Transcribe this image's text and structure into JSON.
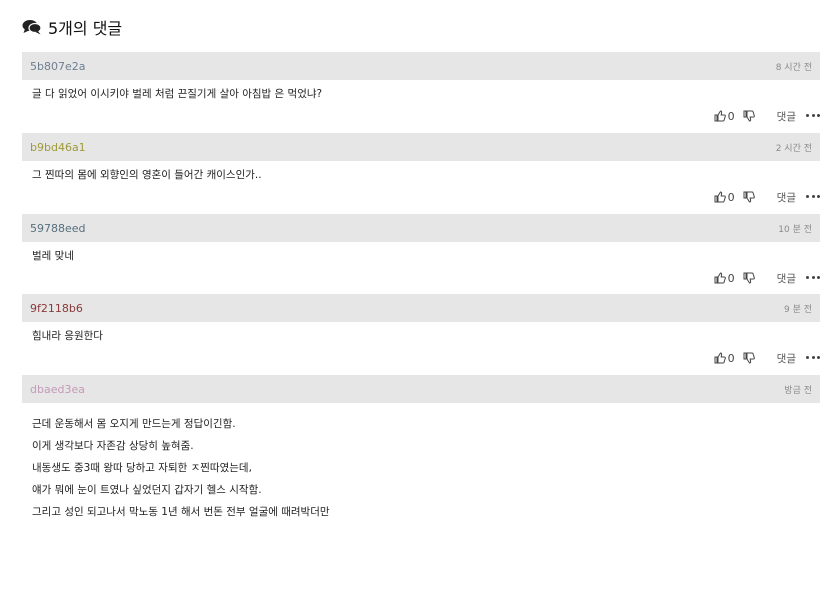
{
  "header": {
    "title": "5개의 댓글",
    "icon": "comments-icon"
  },
  "comments": [
    {
      "author": "5b807e2a",
      "author_color": "#6e7f90",
      "time": "8 시간 전",
      "text": "글 다 읽었어 이시키야 벌레 처럼 끈질기게 살아 아침밥 은 먹었냐?",
      "likes": "0",
      "reply_label": "댓글"
    },
    {
      "author": "b9bd46a1",
      "author_color": "#a09a3a",
      "time": "2 시간 전",
      "text": "그 찐따의 몸에 외향인의 영혼이 들어간 캐이스인가..",
      "likes": "0",
      "reply_label": "댓글"
    },
    {
      "author": "59788eed",
      "author_color": "#56707f",
      "time": "10 분 전",
      "text": "벌레 맞네",
      "likes": "0",
      "reply_label": "댓글"
    },
    {
      "author": "9f2118b6",
      "author_color": "#8a3a3a",
      "time": "9 분 전",
      "text": "힘내라 응원한다",
      "likes": "0",
      "reply_label": "댓글"
    },
    {
      "author": "dbaed3ea",
      "author_color": "#c49ab8",
      "time": "방금 전",
      "lines": [
        "근데 운동해서 몸 오지게 만드는게 정답이긴함.",
        "이게 생각보다 자존감 상당히 높혀줌.",
        "내동생도 중3때 왕따 당하고 자퇴한 ㅈ찐따였는데,",
        "얘가 뭐에 눈이 트였나 싶었던지 갑자기 헬스 시작함.",
        "그리고 성인 되고나서 막노동 1년 해서 번돈 전부 얼굴에 때려박더만"
      ]
    }
  ]
}
